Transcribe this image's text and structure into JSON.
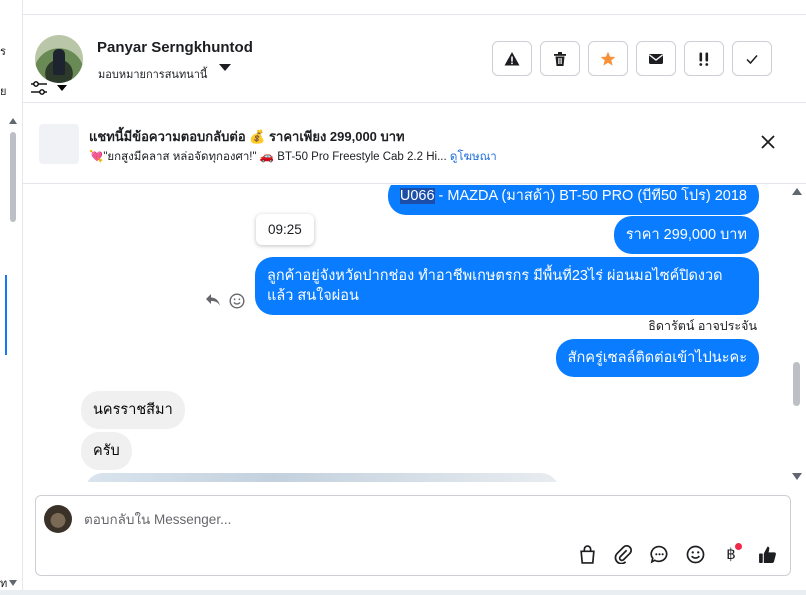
{
  "left_strip": {
    "labels": [
      "ร",
      "ย",
      "ท"
    ]
  },
  "header": {
    "name": "Panyar Serngkhuntod",
    "assign_label": "มอบหมายการสนทนานี้",
    "actions": [
      {
        "name": "warning",
        "glyph": "⚠"
      },
      {
        "name": "trash",
        "glyph": "🗑"
      },
      {
        "name": "star",
        "glyph": "★"
      },
      {
        "name": "mail",
        "glyph": "✉"
      },
      {
        "name": "priority",
        "glyph": "!!"
      },
      {
        "name": "done",
        "glyph": "✓"
      }
    ]
  },
  "ad_banner": {
    "title": "แชทนี้มีข้อความตอบกลับต่อ 💰 ราคาเพียง 299,000 บาท",
    "sub_prefix": "💘\"ยกสูงมีคลาส หล่อจัดทุกองศา!\" 🚗 BT-50 Pro Freestyle Cab 2.2 Hi...",
    "link": "ดูโฆษณา"
  },
  "messages": {
    "m1_code": "U066",
    "m1_rest": " - MAZDA (มาสด้า) BT-50 PRO (บีที50 โปร) 2018",
    "m2": "ราคา 299,000 บาท",
    "m3": "ลูกค้าอยู่จังหวัดปากช่อง ทำอาชีพเกษตรกร มีพื้นที่23ไร่ ผ่อนมอไซค์ปิดงวดแล้ว สนใจผ่อน",
    "sender": "ธิดารัตน์ อาจประจัน",
    "m4": "สักครู่เซลล์ติดต่อเข้าไปนะคะ",
    "in1": "นครราชสีมา",
    "in2": "ครับ",
    "timestamp": "09:25"
  },
  "composer": {
    "placeholder": "ตอบกลับใน Messenger...",
    "tools": [
      "bag-icon",
      "paperclip-icon",
      "chat-bubble-icon",
      "emoji-icon",
      "baht-icon",
      "thumbs-up-icon"
    ],
    "baht_glyph": "฿"
  },
  "colors": {
    "accent": "#0a7cff",
    "star": "#f7923a",
    "link": "#216fdb"
  }
}
